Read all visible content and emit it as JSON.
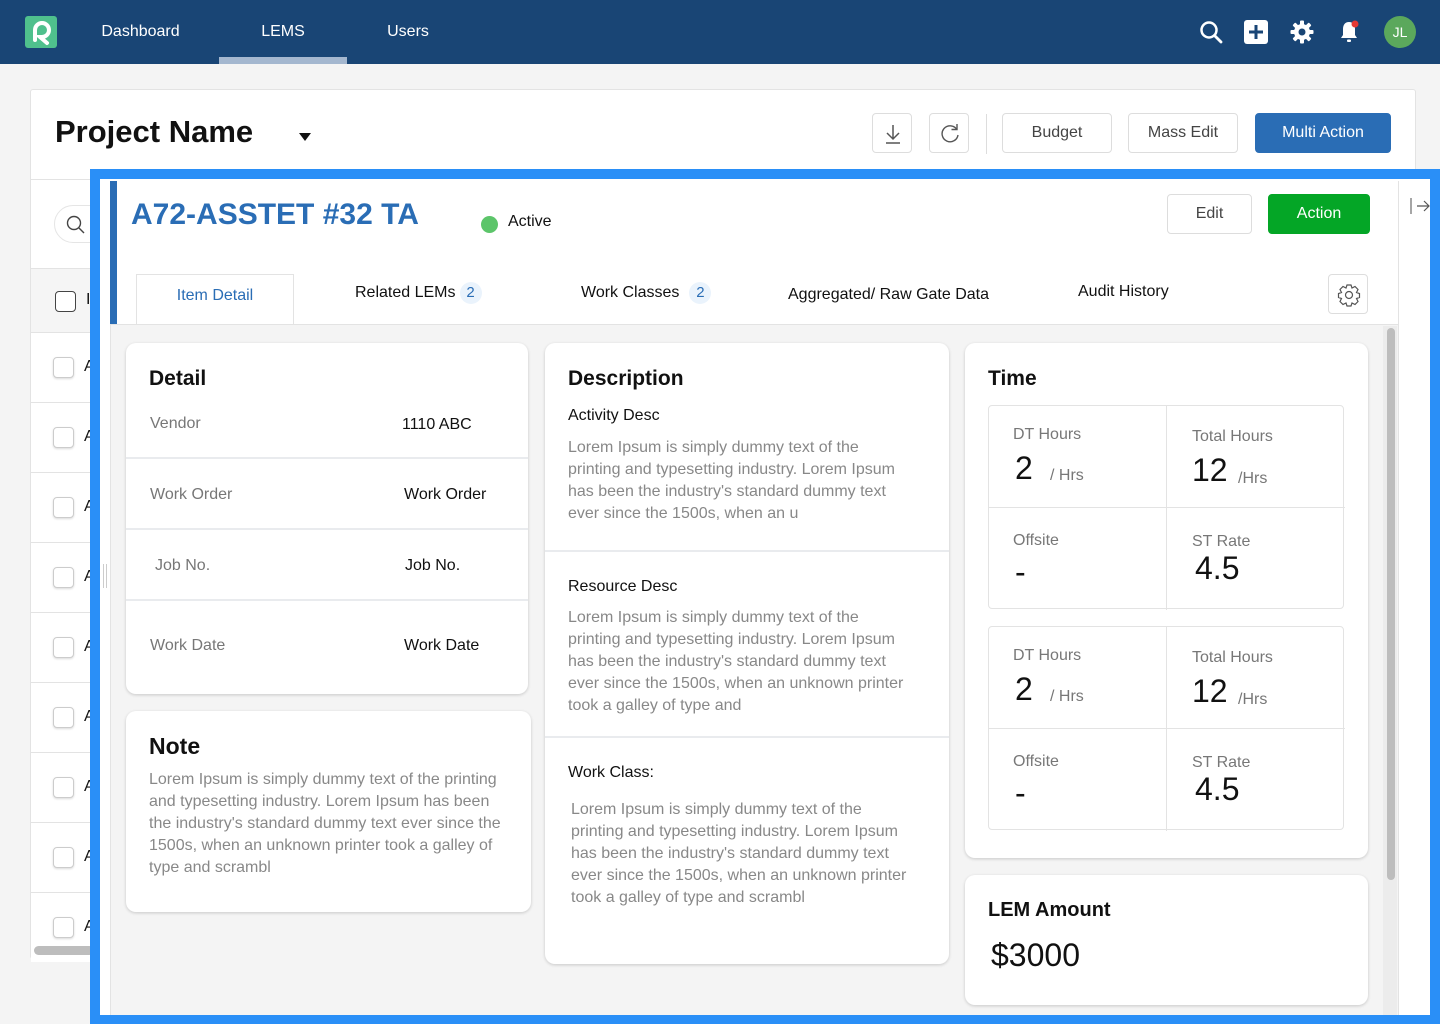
{
  "nav": {
    "items": [
      {
        "label": "Dashboard",
        "active": false
      },
      {
        "label": "LEMS",
        "active": true
      },
      {
        "label": "Users",
        "active": false
      }
    ],
    "icons": [
      "search-icon",
      "add-icon",
      "settings-icon",
      "notification-bell-icon"
    ],
    "user_initials": "JL",
    "has_notification": true
  },
  "project": {
    "title": "Project Name",
    "toolbar": {
      "download_icon": "download-icon",
      "refresh_icon": "refresh-icon",
      "budget_label": "Budget",
      "mass_edit_label": "Mass Edit",
      "multi_action_label": "Multi Action"
    }
  },
  "list": {
    "header_checkbox_checked": false,
    "header_label_initial": "I",
    "rows": [
      {
        "initial": "A"
      },
      {
        "initial": "A"
      },
      {
        "initial": "A"
      },
      {
        "initial": "A"
      },
      {
        "initial": "A"
      },
      {
        "initial": "A"
      },
      {
        "initial": "A"
      },
      {
        "initial": "A"
      },
      {
        "initial": "A"
      }
    ]
  },
  "detail": {
    "title": "A72-ASSTET #32 TA",
    "status": "Active",
    "status_color": "#5cc56a",
    "edit_label": "Edit",
    "action_label": "Action",
    "tabs": [
      {
        "label": "Item Detail",
        "active": true
      },
      {
        "label": "Related LEMs",
        "badge": "2"
      },
      {
        "label": "Work Classes",
        "badge": "2"
      },
      {
        "label": "Aggregated/ Raw Gate Data"
      },
      {
        "label": "Audit History"
      }
    ],
    "detail_card": {
      "title": "Detail",
      "rows": [
        {
          "label": "Vendor",
          "value": "1110 ABC"
        },
        {
          "label": "Work Order",
          "value": "Work Order"
        },
        {
          "label": "Job No.",
          "value": "Job No."
        },
        {
          "label": "Work Date",
          "value": "Work Date"
        }
      ]
    },
    "note_card": {
      "title": "Note",
      "text": "Lorem Ipsum is simply dummy text of the printing and typesetting industry. Lorem Ipsum has been the industry's standard dummy text ever since the 1500s, when an unknown printer took a galley of type and scrambl"
    },
    "description_card": {
      "title": "Description",
      "sections": [
        {
          "label": "Activity Desc",
          "text": "Lorem Ipsum is simply dummy text of the printing and typesetting industry. Lorem Ipsum has been the industry's standard dummy text ever since the 1500s, when an u"
        },
        {
          "label": "Resource Desc",
          "text": "Lorem Ipsum is simply dummy text of the printing and typesetting industry. Lorem Ipsum has been the industry's standard dummy text ever since the 1500s, when an unknown printer took a galley of type and"
        },
        {
          "label": "Work Class:",
          "text": "Lorem Ipsum is simply dummy text of the printing and typesetting industry. Lorem Ipsum has been the industry's standard dummy text ever since the 1500s, when an unknown printer took a galley of type and scrambl"
        }
      ]
    },
    "time_card": {
      "title": "Time",
      "groups": [
        {
          "dt_label": "DT Hours",
          "dt_value": "2",
          "dt_unit": "/ Hrs",
          "total_label": "Total Hours",
          "total_value": "12",
          "total_unit": "/Hrs",
          "offsite_label": "Offsite",
          "offsite_value": "-",
          "st_label": "ST Rate",
          "st_value": "4.5"
        },
        {
          "dt_label": "DT Hours",
          "dt_value": "2",
          "dt_unit": "/ Hrs",
          "total_label": "Total Hours",
          "total_value": "12",
          "total_unit": "/Hrs",
          "offsite_label": "Offsite",
          "offsite_value": "-",
          "st_label": "ST Rate",
          "st_value": "4.5"
        }
      ]
    },
    "amount_card": {
      "title": "LEM Amount",
      "value": "$3000"
    }
  }
}
